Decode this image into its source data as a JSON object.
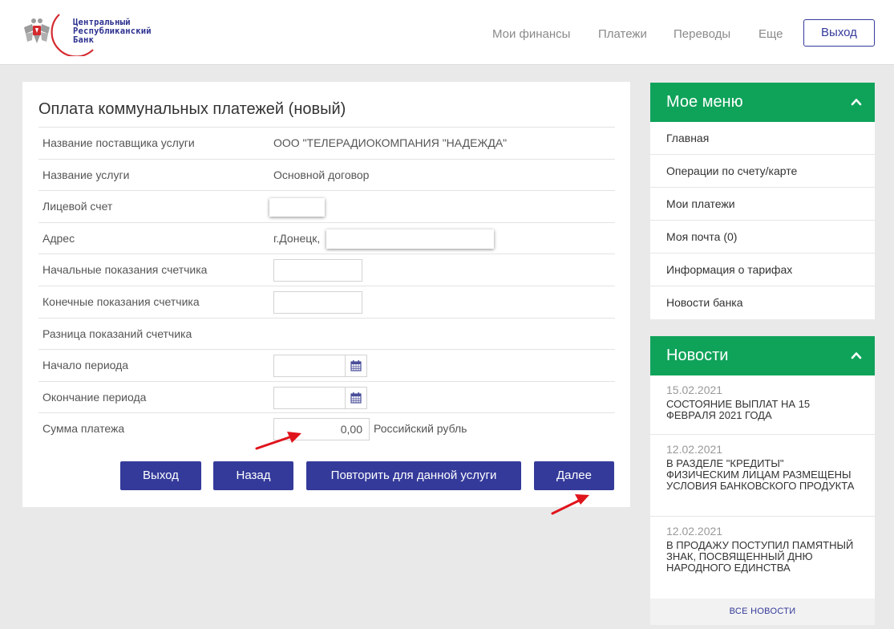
{
  "header": {
    "logo_text": "Центральный\nРеспубликанский\nБанк",
    "nav": [
      "Мои финансы",
      "Платежи",
      "Переводы",
      "Еще"
    ],
    "logout_label": "Выход"
  },
  "form": {
    "title": "Оплата коммунальных платежей (новый)",
    "rows": [
      {
        "label": "Название поставщика услуги",
        "value": "ООО \"ТЕЛЕРАДИОКОМПАНИЯ \"НАДЕЖДА\""
      },
      {
        "label": "Название услуги",
        "value": "Основной договор"
      },
      {
        "label": "Лицевой счет",
        "value": ""
      },
      {
        "label": "Адрес",
        "value": "г.Донецк,"
      },
      {
        "label": "Начальные показания счетчика",
        "value": ""
      },
      {
        "label": "Конечные показания счетчика",
        "value": ""
      },
      {
        "label": "Разница показаний счетчика",
        "value": ""
      },
      {
        "label": "Начало периода",
        "value": ""
      },
      {
        "label": "Окончание периода",
        "value": ""
      },
      {
        "label": "Сумма платежа",
        "value": "0,00",
        "currency": "Российский рубль"
      }
    ],
    "buttons": {
      "exit": "Выход",
      "back": "Назад",
      "repeat": "Повторить для данной услуги",
      "next": "Далее"
    }
  },
  "menu": {
    "title": "Мое меню",
    "items": [
      "Главная",
      "Операции по счету/карте",
      "Мои платежи",
      "Моя почта (0)",
      "Информация о тарифах",
      "Новости банка"
    ]
  },
  "news": {
    "title": "Новости",
    "items": [
      {
        "date": "15.02.2021",
        "title": "СОСТОЯНИЕ ВЫПЛАТ НА 15 ФЕВРАЛЯ 2021 ГОДА"
      },
      {
        "date": "12.02.2021",
        "title": "В РАЗДЕЛЕ \"КРЕДИТЫ\" ФИЗИЧЕСКИМ ЛИЦАМ РАЗМЕЩЕНЫ УСЛОВИЯ БАНКОВСКОГО ПРОДУКТА"
      },
      {
        "date": "12.02.2021",
        "title": "В ПРОДАЖУ ПОСТУПИЛ ПАМЯТНЫЙ ЗНАК, ПОСВЯЩЕННЫЙ ДНЮ НАРОДНОГО ЕДИНСТВА"
      }
    ],
    "all_label": "ВСЕ НОВОСТИ"
  },
  "colors": {
    "brand_blue": "#343a9a",
    "sidebar_green": "#0fa35a",
    "logo_red": "#d42a2f",
    "annotation_red": "#e0141c"
  }
}
